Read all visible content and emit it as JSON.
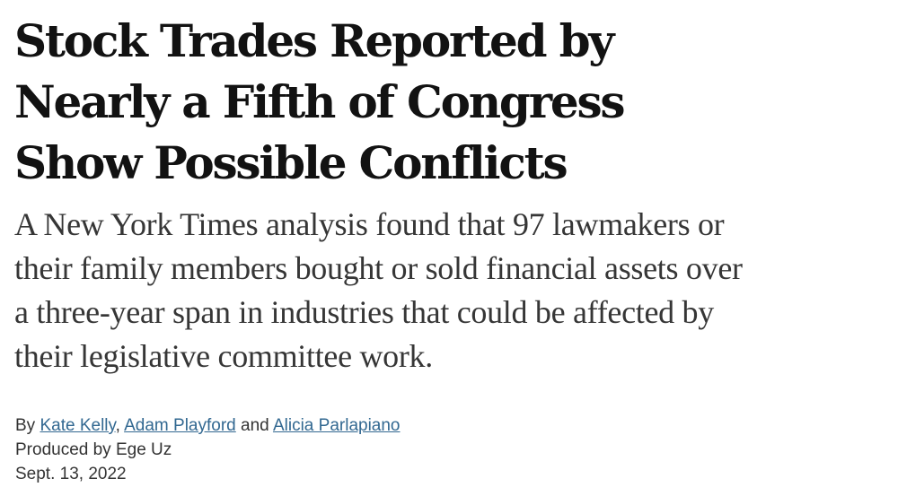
{
  "article": {
    "headline_lines": [
      "Stock Trades Reported by",
      "Nearly a Fifth of Congress",
      "Show Possible Conflicts"
    ],
    "summary_lines": [
      "A New York Times analysis found that 97 lawmakers or",
      "their family members bought or sold financial assets over",
      "a three-year span in industries that could be affected by",
      "their legislative committee work."
    ],
    "byline": {
      "prefix": "By",
      "authors": [
        "Kate Kelly",
        "Adam Playford",
        "Alicia Parlapiano"
      ],
      "separator_1": ",",
      "separator_2": "and"
    },
    "producer": "Produced by Ege Uz",
    "date": "Sept. 13, 2022"
  }
}
